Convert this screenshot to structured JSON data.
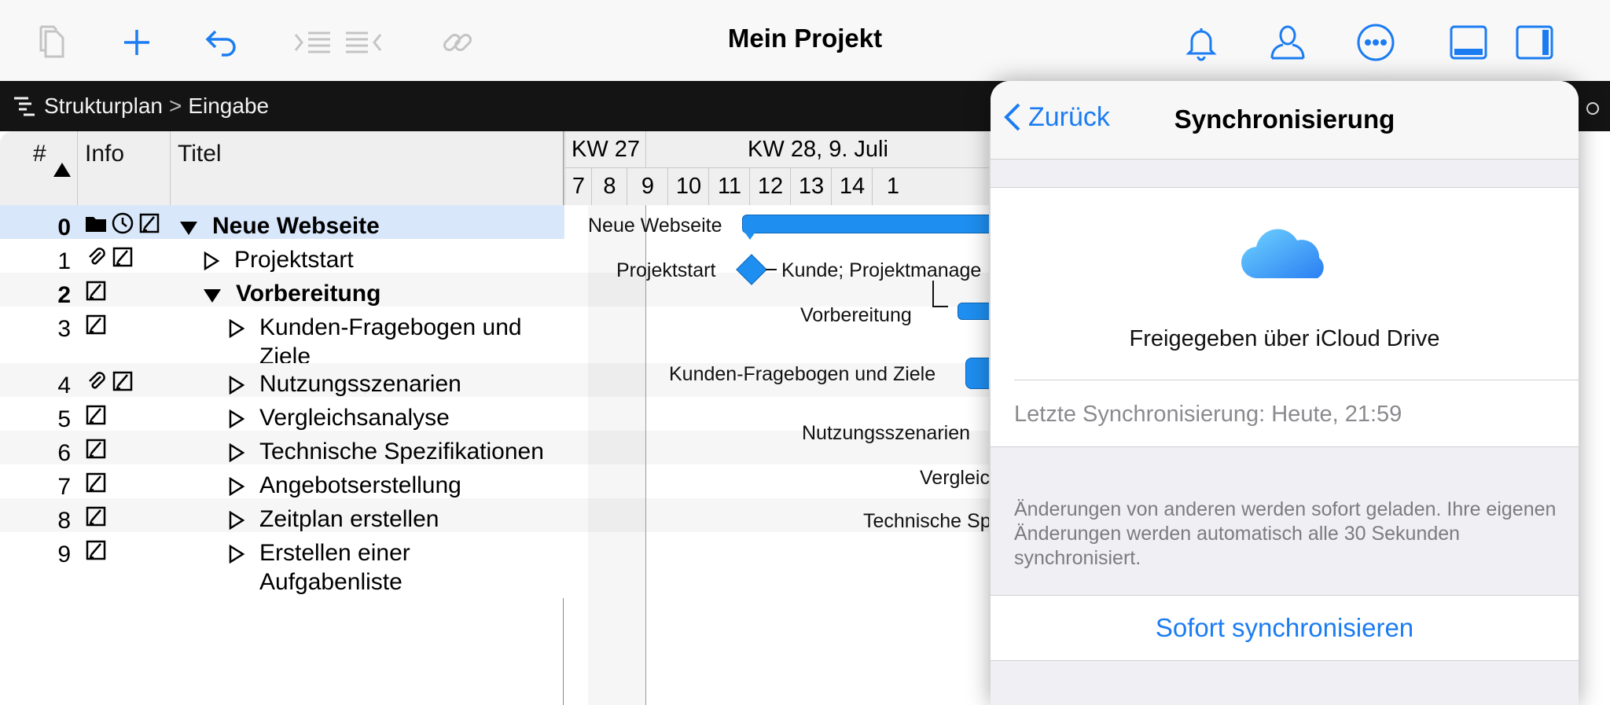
{
  "toolbar": {
    "title": "Mein Projekt",
    "left_icons": [
      "copy-icon",
      "add-icon",
      "undo-icon",
      "indent-icon",
      "outdent-icon",
      "link-icon"
    ],
    "right_icons": [
      "bell-icon",
      "user-icon",
      "more-icon",
      "bottom-panel-icon",
      "side-panel-icon"
    ],
    "accent": "#1b7cf2"
  },
  "breadcrumb": {
    "view": "Strukturplan",
    "separator": ">",
    "page": "Eingabe"
  },
  "table": {
    "headers": {
      "num": "#",
      "info": "Info",
      "title": "Titel"
    },
    "rows": [
      {
        "num": "0",
        "title": "Neue Webseite",
        "bold": true,
        "expanded": true,
        "level": 0,
        "icons": [
          "folder-icon",
          "clock-icon",
          "note-icon"
        ]
      },
      {
        "num": "1",
        "title": "Projektstart",
        "bold": false,
        "expanded": false,
        "level": 1,
        "icons": [
          "attachment-icon",
          "note-icon"
        ]
      },
      {
        "num": "2",
        "title": "Vorbereitung",
        "bold": true,
        "expanded": true,
        "level": 1,
        "icons": [
          "note-icon"
        ]
      },
      {
        "num": "3",
        "title": "Kunden-Fragebogen und Ziele",
        "bold": false,
        "expanded": false,
        "level": 2,
        "icons": [
          "note-icon"
        ]
      },
      {
        "num": "4",
        "title": "Nutzungsszenarien",
        "bold": false,
        "expanded": false,
        "level": 2,
        "icons": [
          "attachment-icon",
          "note-icon"
        ]
      },
      {
        "num": "5",
        "title": "Vergleichsanalyse",
        "bold": false,
        "expanded": false,
        "level": 2,
        "icons": [
          "note-icon"
        ]
      },
      {
        "num": "6",
        "title": "Technische Spezifikationen",
        "bold": false,
        "expanded": false,
        "level": 2,
        "icons": [
          "note-icon"
        ]
      },
      {
        "num": "7",
        "title": "Angebotserstellung",
        "bold": false,
        "expanded": false,
        "level": 2,
        "icons": [
          "note-icon"
        ]
      },
      {
        "num": "8",
        "title": "Zeitplan erstellen",
        "bold": false,
        "expanded": false,
        "level": 2,
        "icons": [
          "note-icon"
        ]
      },
      {
        "num": "9",
        "title": "Erstellen einer Aufgabenliste",
        "bold": false,
        "expanded": false,
        "level": 2,
        "icons": [
          "note-icon"
        ]
      }
    ]
  },
  "gantt": {
    "weeks": [
      "KW 27",
      "KW 28, 9. Juli"
    ],
    "days": [
      "7",
      "8",
      "9",
      "10",
      "11",
      "12",
      "13",
      "14",
      "1"
    ],
    "labels": {
      "row0": "Neue Webseite",
      "row1": "Projektstart",
      "row1_resource": "Kunde; Projektmanage",
      "row2": "Vorbereitung",
      "row3": "Kunden-Fragebogen und Ziele",
      "row4": "Nutzungsszenarien",
      "row5": "Vergleic",
      "row6": "Technische Sp"
    },
    "bar_color": "#1e8ef0"
  },
  "popover": {
    "back_label": "Zurück",
    "title": "Synchronisierung",
    "cloud_icon": "icloud-icon",
    "shared_text": "Freigegeben über iCloud Drive",
    "last_sync": "Letzte Synchronisierung: Heute, 21:59",
    "note": "Änderungen von anderen werden sofort geladen. Ihre eigenen Änderungen werden automatisch alle 30 Sekunden synchronisiert.",
    "sync_button": "Sofort synchronisieren"
  }
}
